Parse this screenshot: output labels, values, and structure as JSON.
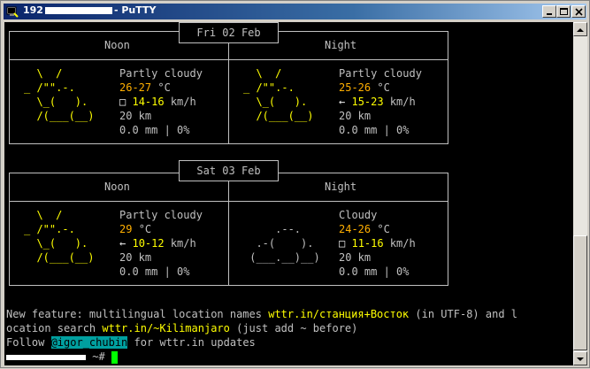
{
  "window": {
    "title_prefix": "192",
    "title_suffix": "- PuTTY",
    "buttons": [
      "minimize",
      "maximize",
      "close"
    ]
  },
  "forecast": [
    {
      "date": "Fri 02 Feb",
      "periods": [
        {
          "name": "Noon",
          "art_style": "partly-cloudy",
          "art": [
            "  \\  /      ",
            "_ /\"\".-.    ",
            "  \\_(   ).  ",
            "  /(___(__) "
          ],
          "condition": "Partly cloudy",
          "temp": "26-27",
          "temp_unit": "°C",
          "wind_icon": "□",
          "wind": "14-16",
          "wind_unit": "km/h",
          "visibility": "20 km",
          "precip": "0.0 mm | 0%"
        },
        {
          "name": "Night",
          "art_style": "partly-cloudy",
          "art": [
            "  \\  /      ",
            "_ /\"\".-.    ",
            "  \\_(   ).  ",
            "  /(___(__) "
          ],
          "condition": "Partly cloudy",
          "temp": "25-26",
          "temp_unit": "°C",
          "wind_icon": "←",
          "wind": "15-23",
          "wind_unit": "km/h",
          "visibility": "20 km",
          "precip": "0.0 mm | 0%"
        }
      ]
    },
    {
      "date": "Sat 03 Feb",
      "periods": [
        {
          "name": "Noon",
          "art_style": "partly-cloudy",
          "art": [
            "  \\  /      ",
            "_ /\"\".-.    ",
            "  \\_(   ).  ",
            "  /(___(__) "
          ],
          "condition": "Partly cloudy",
          "temp": "29",
          "temp_unit": "°C",
          "wind_icon": "←",
          "wind": "10-12",
          "wind_unit": "km/h",
          "visibility": "20 km",
          "precip": "0.0 mm | 0%"
        },
        {
          "name": "Night",
          "art_style": "cloudy",
          "art": [
            "             ",
            "     .--.    ",
            "  .-(    ).  ",
            " (___.__)__) "
          ],
          "condition": "Cloudy",
          "temp": "24-26",
          "temp_unit": "°C",
          "wind_icon": "□",
          "wind": "11-16",
          "wind_unit": "km/h",
          "visibility": "20 km",
          "precip": "0.0 mm | 0%"
        }
      ]
    }
  ],
  "footer": {
    "feature_prefix": "New feature: multilingual location names ",
    "feature_example": "wttr.in/станция+Восток",
    "feature_suffix": " (in UTF-8) and l",
    "line2_prefix": "ocation search ",
    "line2_example": "wttr.in/~Kilimanjaro",
    "line2_suffix": " (just add ~ before)",
    "follow_prefix": "Follow ",
    "follow_handle": "@igor_chubin",
    "follow_suffix": " for wttr.in updates",
    "prompt_suffix": " ~#"
  },
  "colors": {
    "terminal_bg": "#000000",
    "text": "#c0c0c0",
    "art_yellow": "#ffff00",
    "temp_orange": "#ffaf00",
    "wind_yellow": "#ffff00",
    "highlight_bg": "#00a0a0",
    "cursor": "#00ff00",
    "title_start": "#0a246a"
  }
}
